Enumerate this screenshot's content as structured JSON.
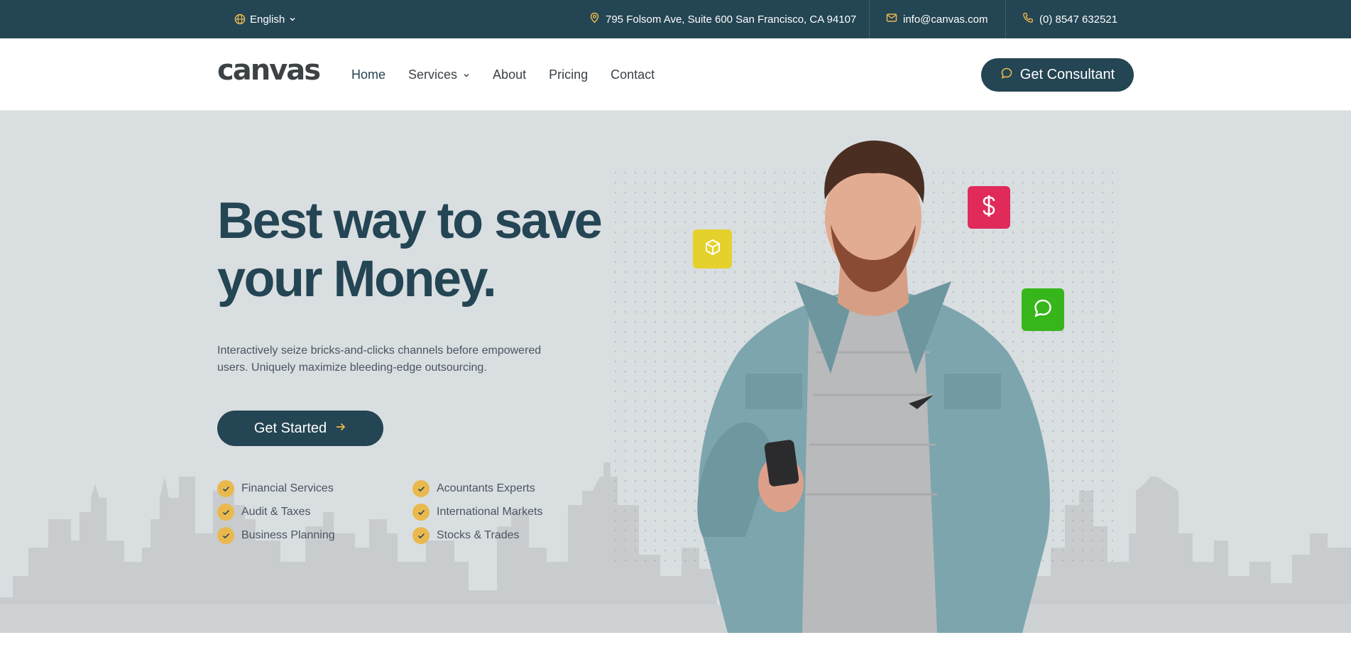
{
  "topbar": {
    "language": "English",
    "address": "795 Folsom Ave, Suite 600 San Francisco, CA 94107",
    "email": "info@canvas.com",
    "phone": "(0) 8547 632521"
  },
  "nav": {
    "logo": "canvas",
    "items": [
      {
        "label": "Home"
      },
      {
        "label": "Services"
      },
      {
        "label": "About"
      },
      {
        "label": "Pricing"
      },
      {
        "label": "Contact"
      }
    ],
    "cta_label": "Get Consultant"
  },
  "hero": {
    "headline_line1": "Best way to save",
    "headline_line2": "your Money.",
    "description": "Interactively seize bricks-and-clicks channels before empowered users. Uniquely maximize bleeding-edge outsourcing.",
    "button_label": "Get Started",
    "features": [
      "Financial Services",
      "Acountants Experts",
      "Audit & Taxes",
      "International Markets",
      "Business Planning",
      "Stocks & Trades"
    ]
  },
  "icons": {
    "language": "globe-icon",
    "address": "map-pin-icon",
    "email": "mail-icon",
    "phone": "phone-icon",
    "cta": "chat-bubble-icon",
    "button": "arrow-right-icon",
    "feature": "check-icon",
    "badge_yellow": "box-icon",
    "badge_pink": "dollar-icon",
    "badge_green": "chat-bubble-icon"
  },
  "colors": {
    "primary": "#244553",
    "accent": "#eab94d",
    "hero_bg": "#d9dee1",
    "badge_yellow": "#e4d12c",
    "badge_pink": "#e02a5a",
    "badge_green": "#37b61b"
  }
}
